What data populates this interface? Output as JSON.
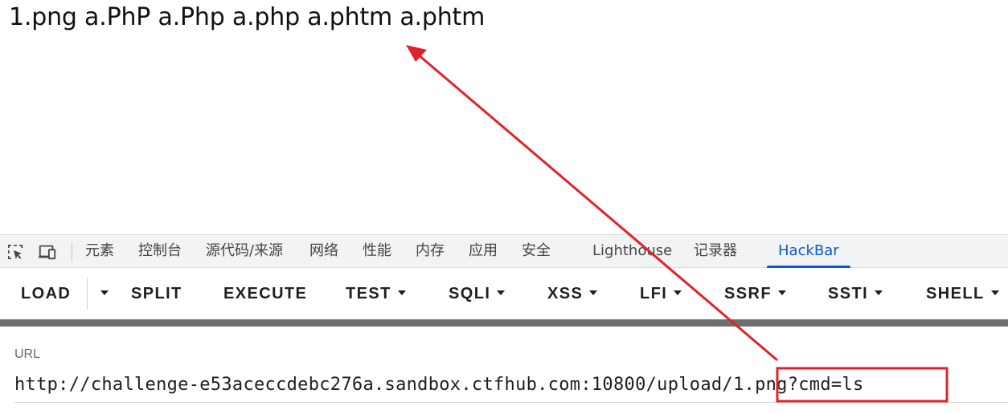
{
  "page_output": {
    "text": "1.png a.PhP a.Php a.php a.phtm a.phtm"
  },
  "devtools": {
    "tabs": [
      {
        "label": "元素"
      },
      {
        "label": "控制台"
      },
      {
        "label": "源代码/来源"
      },
      {
        "label": "网络"
      },
      {
        "label": "性能"
      },
      {
        "label": "内存"
      },
      {
        "label": "应用"
      },
      {
        "label": "安全"
      },
      {
        "label": "Lighthouse"
      },
      {
        "label": "记录器"
      },
      {
        "label": "HackBar"
      }
    ],
    "active_tab": "HackBar",
    "icons": [
      "inspect-element-icon",
      "device-toolbar-icon"
    ]
  },
  "hackbar": {
    "buttons": [
      {
        "label": "LOAD",
        "dropdown": false
      },
      {
        "label": "SPLIT",
        "dropdown": false
      },
      {
        "label": "EXECUTE",
        "dropdown": false
      },
      {
        "label": "TEST",
        "dropdown": true
      },
      {
        "label": "SQLI",
        "dropdown": true
      },
      {
        "label": "XSS",
        "dropdown": true
      },
      {
        "label": "LFI",
        "dropdown": true
      },
      {
        "label": "SSRF",
        "dropdown": true
      },
      {
        "label": "SSTI",
        "dropdown": true
      },
      {
        "label": "SHELL",
        "dropdown": true
      }
    ],
    "url_label": "URL",
    "url_value": "http://challenge-e53aceccdebc276a.sandbox.ctfhub.com:10800/upload/1.png?cmd=ls"
  },
  "colors": {
    "active_tab": "#0b57d0",
    "annotation": "#e0232b"
  }
}
